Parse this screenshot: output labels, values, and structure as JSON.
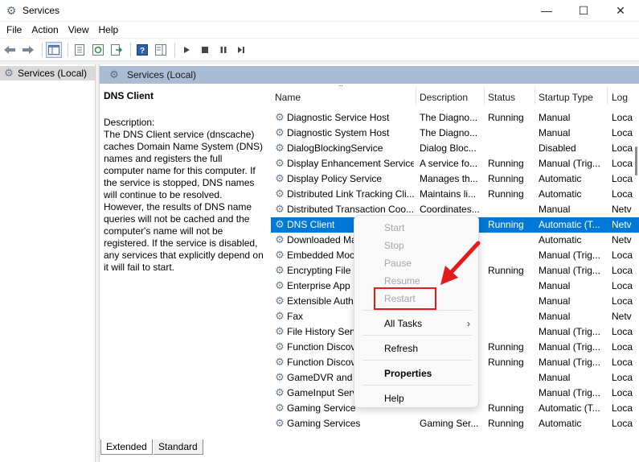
{
  "window": {
    "title": "Services",
    "minimize": "—",
    "maximize": "☐",
    "close": "✕"
  },
  "menu": [
    "File",
    "Action",
    "View",
    "Help"
  ],
  "tree": {
    "root_label": "Services (Local)"
  },
  "pane": {
    "header": "Services (Local)",
    "service_name": "DNS Client",
    "description_label": "Description:",
    "description_body": "The DNS Client service (dnscache) caches Domain Name System (DNS) names and registers the full computer name for this computer. If the service is stopped, DNS names will continue to be resolved. However, the results of DNS name queries will not be cached and the computer's name will not be registered. If the service is disabled, any services that explicitly depend on it will fail to start."
  },
  "columns": {
    "name": "Name",
    "description": "Description",
    "status": "Status",
    "startup": "Startup Type",
    "logon": "Log"
  },
  "rows": [
    {
      "name": "Diagnostic Service Host",
      "description": "The Diagno...",
      "status": "Running",
      "startup": "Manual",
      "logon": "Loca"
    },
    {
      "name": "Diagnostic System Host",
      "description": "The Diagno...",
      "status": "",
      "startup": "Manual",
      "logon": "Loca"
    },
    {
      "name": "DialogBlockingService",
      "description": "Dialog Bloc...",
      "status": "",
      "startup": "Disabled",
      "logon": "Loca"
    },
    {
      "name": "Display Enhancement Service",
      "description": "A service fo...",
      "status": "Running",
      "startup": "Manual (Trig...",
      "logon": "Loca"
    },
    {
      "name": "Display Policy Service",
      "description": "Manages th...",
      "status": "Running",
      "startup": "Automatic",
      "logon": "Loca"
    },
    {
      "name": "Distributed Link Tracking Cli...",
      "description": "Maintains li...",
      "status": "Running",
      "startup": "Automatic",
      "logon": "Loca"
    },
    {
      "name": "Distributed Transaction Coo...",
      "description": "Coordinates...",
      "status": "",
      "startup": "Manual",
      "logon": "Netv"
    },
    {
      "name": "DNS Client",
      "description": "",
      "status": "Running",
      "startup": "Automatic (T...",
      "logon": "Netv",
      "selected": true
    },
    {
      "name": "Downloaded Ma",
      "description": "",
      "status": "",
      "startup": "Automatic",
      "logon": "Netv"
    },
    {
      "name": "Embedded Moc",
      "description": "",
      "status": "",
      "startup": "Manual (Trig...",
      "logon": "Loca"
    },
    {
      "name": "Encrypting File S",
      "description": "",
      "status": "Running",
      "startup": "Manual (Trig...",
      "logon": "Loca"
    },
    {
      "name": "Enterprise App M",
      "description": "",
      "status": "",
      "startup": "Manual",
      "logon": "Loca"
    },
    {
      "name": "Extensible Auth",
      "description": "",
      "status": "",
      "startup": "Manual",
      "logon": "Loca"
    },
    {
      "name": "Fax",
      "description": "",
      "status": "",
      "startup": "Manual",
      "logon": "Netv"
    },
    {
      "name": "File History Serv",
      "description": "",
      "status": "",
      "startup": "Manual (Trig...",
      "logon": "Loca"
    },
    {
      "name": "Function Discov",
      "description": "",
      "status": "Running",
      "startup": "Manual (Trig...",
      "logon": "Loca"
    },
    {
      "name": "Function Discov",
      "description": "",
      "status": "Running",
      "startup": "Manual (Trig...",
      "logon": "Loca"
    },
    {
      "name": "GameDVR and E",
      "description": "",
      "status": "",
      "startup": "Manual",
      "logon": "Loca"
    },
    {
      "name": "GameInput Serv",
      "description": "",
      "status": "",
      "startup": "Manual (Trig...",
      "logon": "Loca"
    },
    {
      "name": "Gaming Service",
      "description": "",
      "status": "Running",
      "startup": "Automatic (T...",
      "logon": "Loca"
    },
    {
      "name": "Gaming Services",
      "description": "Gaming Ser...",
      "status": "Running",
      "startup": "Automatic",
      "logon": "Loca"
    }
  ],
  "context_menu": {
    "start": "Start",
    "stop": "Stop",
    "pause": "Pause",
    "resume": "Resume",
    "restart": "Restart",
    "all_tasks": "All Tasks",
    "refresh": "Refresh",
    "properties": "Properties",
    "help": "Help"
  },
  "tabs": {
    "extended": "Extended",
    "standard": "Standard"
  },
  "colors": {
    "selection": "#0078d7",
    "pane_header": "#a9bcd3",
    "annotation": "#e21b1b"
  }
}
